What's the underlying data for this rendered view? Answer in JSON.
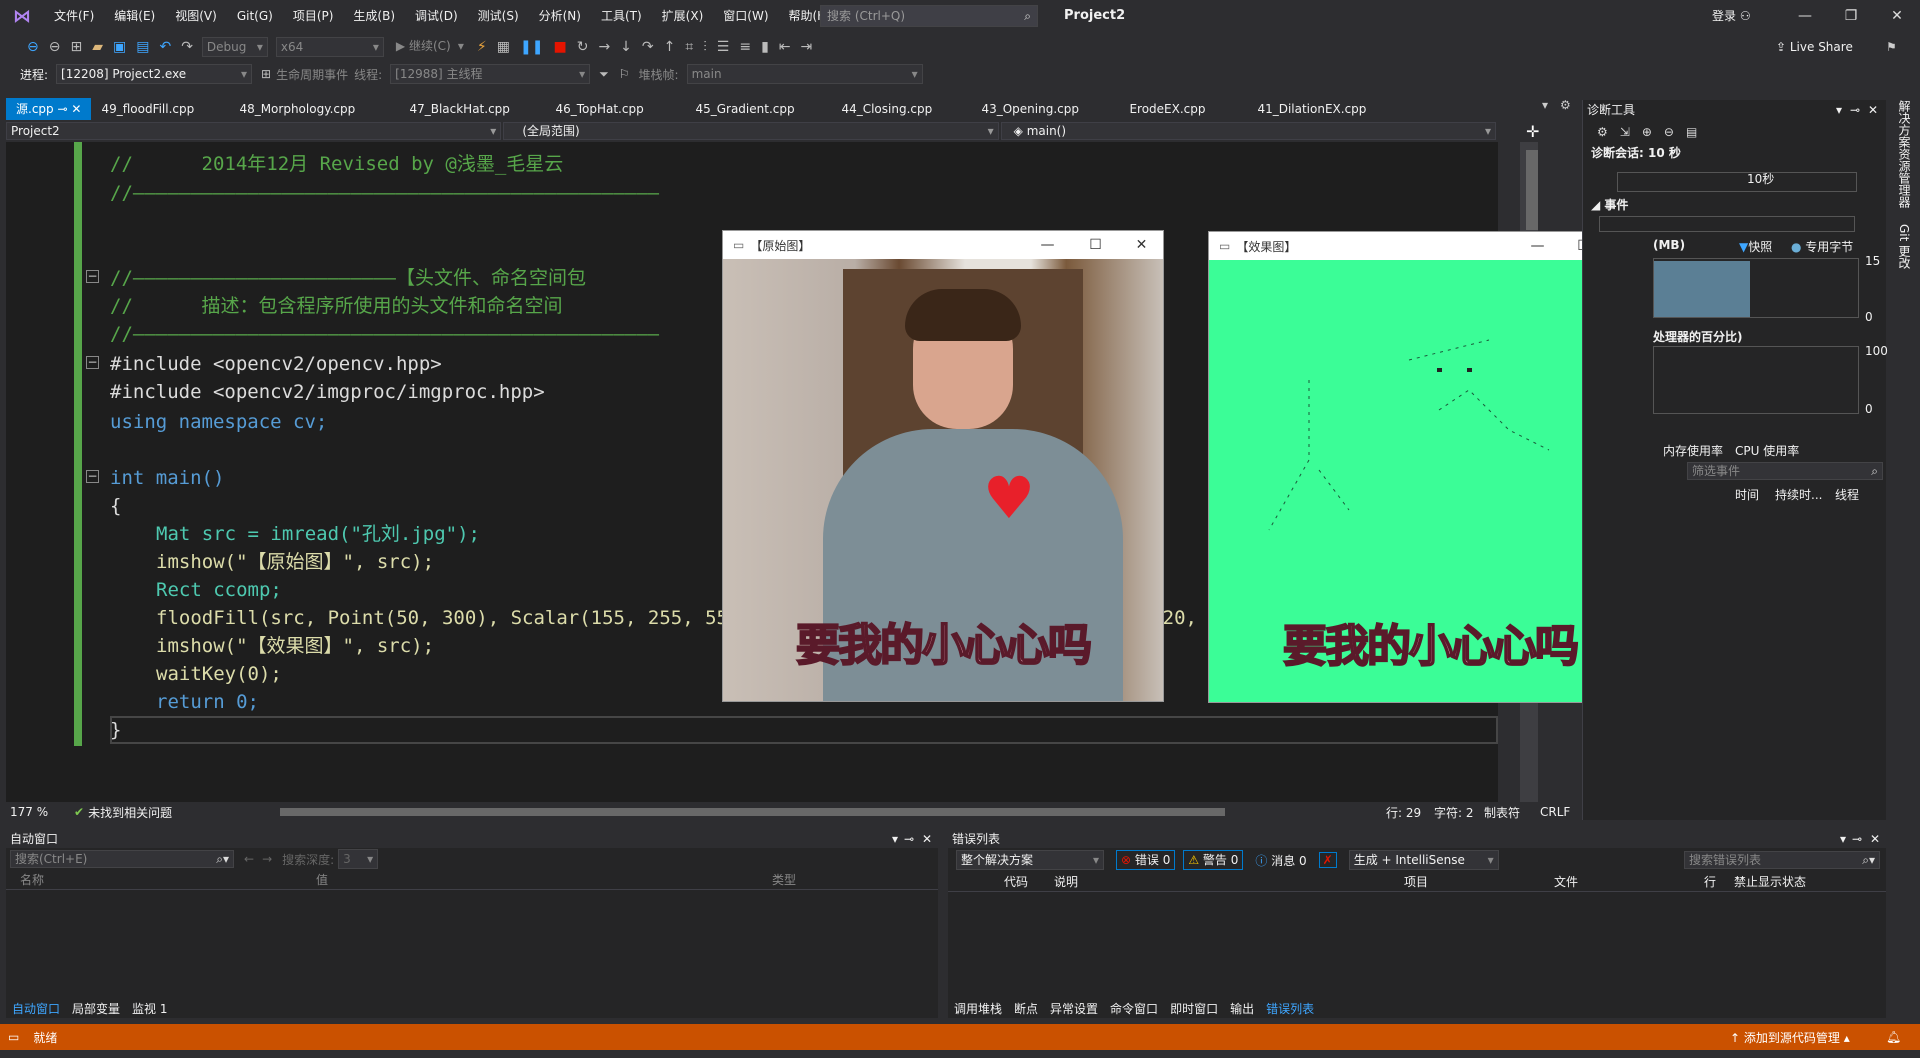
{
  "titlebar": {
    "menu": [
      "文件(F)",
      "编辑(E)",
      "视图(V)",
      "Git(G)",
      "项目(P)",
      "生成(B)",
      "调试(D)",
      "测试(S)",
      "分析(N)",
      "工具(T)",
      "扩展(X)",
      "窗口(W)",
      "帮助(H)"
    ],
    "search_placeholder": "搜索 (Ctrl+Q)",
    "solution": "Project2",
    "signin": "登录"
  },
  "toolbar": {
    "config": "Debug",
    "platform": "x64",
    "continue": "继续(C)",
    "live_share": "Live Share"
  },
  "debugbar": {
    "process_label": "进程:",
    "process": "[12208] Project2.exe",
    "lifecycle": "生命周期事件",
    "thread_label": "线程:",
    "thread": "[12988] 主线程",
    "stack_label": "堆栈帧:",
    "stack": "main"
  },
  "tabs": [
    "源.cpp",
    "49_floodFill.cpp",
    "48_Morphology.cpp",
    "47_BlackHat.cpp",
    "46_TopHat.cpp",
    "45_Gradient.cpp",
    "44_Closing.cpp",
    "43_Opening.cpp",
    "ErodeEX.cpp",
    "41_DilationEX.cpp"
  ],
  "navbar": {
    "project": "Project2",
    "scope": "(全局范围)",
    "func": "main()"
  },
  "editor": {
    "zoom": "177 %",
    "issues": "未找到相关问题",
    "line": "行: 29",
    "col": "字符: 2",
    "tab": "制表符",
    "eol": "CRLF"
  },
  "code": {
    "l1": "//      2014年12月 Revised by @浅墨_毛星云",
    "l2": "//——————————————————————————————————————————————",
    "l3": "//———————————————————————【头文件、命名空间包",
    "l4": "//      描述：包含程序所使用的头文件和命名空间",
    "l5": "//——————————————————————————————————————————————",
    "inc1": "#include <opencv2/opencv.hpp>",
    "inc2": "#include <opencv2/imgproc/imgproc.hpp>",
    "using": "using namespace cv;",
    "main": "int main()",
    "brace_open": "{",
    "s1": "Mat src = imread(\"孔刘.jpg\");",
    "s2": "imshow(\"【原始图】\", src);",
    "s3": "Rect ccomp;",
    "s4": "floodFill(src, Point(50, 300), Scalar(155, 255, 55), &ccomp, Scalar(20, 20, 20), Scalar(20, 20, 20));",
    "s5": "imshow(\"【效果图】\", src);",
    "s6": "waitKey(0);",
    "s7": "return 0;",
    "brace_close": "}"
  },
  "cv_windows": {
    "original_title": "【原始图】",
    "effect_title": "【效果图】",
    "caption": "要我的小心心吗",
    "fill_color": "#3bfd97"
  },
  "diag": {
    "title": "诊断工具",
    "session": "诊断会话: 10 秒",
    "timemark": "10秒",
    "events": "事件",
    "mem_label": "(MB)",
    "snapshot": "快照",
    "private_bytes": "专用字节",
    "mem_max": "15",
    "mem_min": "0",
    "cpu_label": "处理器的百分比)",
    "cpu_max": "100",
    "cpu_min": "0",
    "tab_mem": "内存使用率",
    "tab_cpu": "CPU 使用率",
    "filter_placeholder": "筛选事件",
    "cols": [
      "时间",
      "持续时...",
      "线程"
    ]
  },
  "side_tabs": [
    "解决方案资源管理器",
    "Git 更改"
  ],
  "autowin": {
    "title": "自动窗口",
    "search_placeholder": "搜索(Ctrl+E)",
    "depth_label": "搜索深度:",
    "depth": "3",
    "cols": [
      "名称",
      "值",
      "类型"
    ],
    "tabs": [
      "自动窗口",
      "局部变量",
      "监视 1"
    ]
  },
  "errwin": {
    "title": "错误列表",
    "scope": "整个解决方案",
    "errors": "错误 0",
    "warnings": "警告 0",
    "messages": "消息 0",
    "build": "生成 + IntelliSense",
    "search_placeholder": "搜索错误列表",
    "cols": [
      "代码",
      "说明",
      "项目",
      "文件",
      "行",
      "禁止显示状态"
    ],
    "tabs": [
      "调用堆栈",
      "断点",
      "异常设置",
      "命令窗口",
      "即时窗口",
      "输出",
      "错误列表"
    ]
  },
  "statusbar": {
    "ready": "就绪",
    "source_control": "添加到源代码管理"
  }
}
